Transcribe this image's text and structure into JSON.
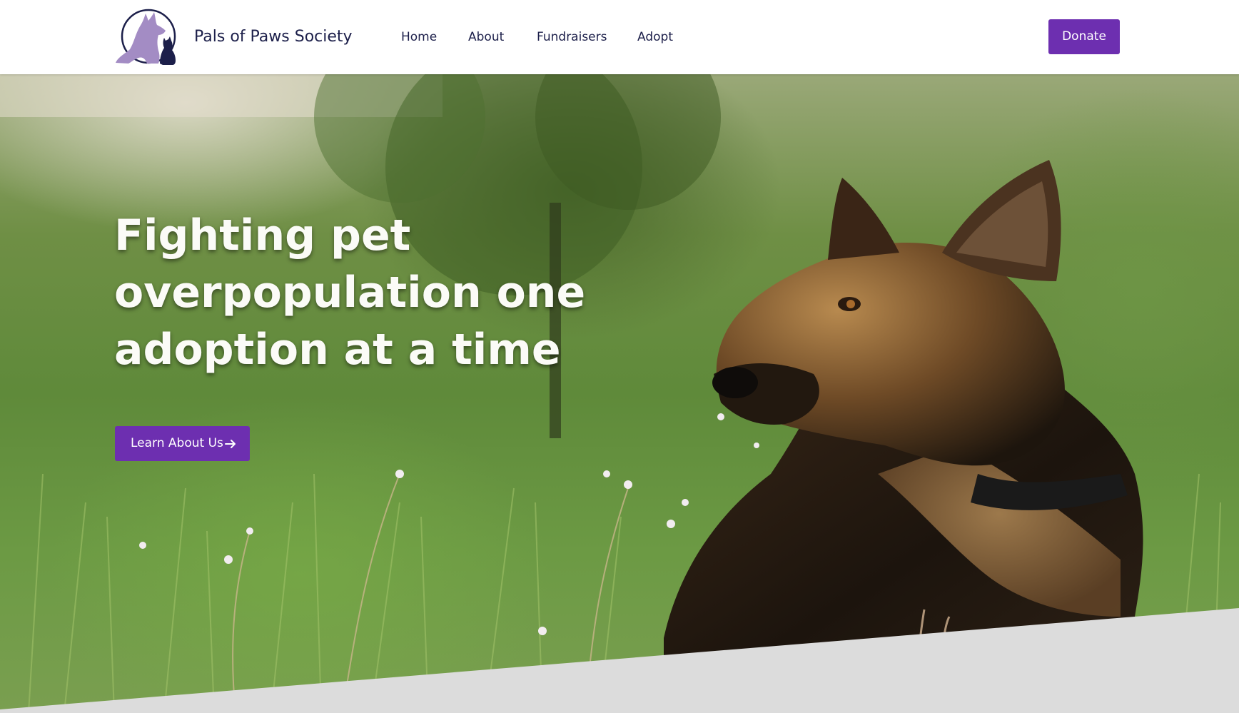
{
  "header": {
    "brand_name": "Pals of Paws Society",
    "nav": [
      {
        "label": "Home"
      },
      {
        "label": "About"
      },
      {
        "label": "Fundraisers"
      },
      {
        "label": "Adopt"
      }
    ],
    "donate_label": "Donate"
  },
  "hero": {
    "title_lines": [
      "Fighting pet",
      "overpopulation one",
      "adoption at a time"
    ],
    "cta_label": "Learn About Us",
    "cta_icon": "arrow-right-icon"
  },
  "colors": {
    "accent": "#6d2fb0",
    "nav_text": "#1c1f4a",
    "logo_purple": "#a38cc4",
    "logo_navy": "#1c1f4a",
    "bottom_band": "#dcdcdc"
  }
}
